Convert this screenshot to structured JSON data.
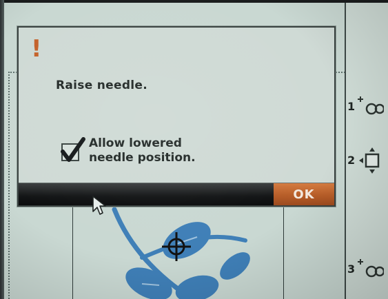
{
  "dialog": {
    "alert_symbol": "!",
    "message": "Raise needle.",
    "checkbox": {
      "checked": true,
      "label_line1": "Allow lowered",
      "label_line2": "needle position."
    },
    "ok_label": "OK"
  },
  "side_panel": {
    "items": [
      {
        "number": "1",
        "icon": "stitch-position-icon"
      },
      {
        "number": "2",
        "icon": "move-frame-icon"
      },
      {
        "number": "3",
        "icon": "stitch-position-icon"
      }
    ]
  },
  "colors": {
    "accent": "#c4622b",
    "ok_button": "#b75d28",
    "screen_background": "#c9d8d2",
    "embroidery": "#3f7fb7"
  }
}
